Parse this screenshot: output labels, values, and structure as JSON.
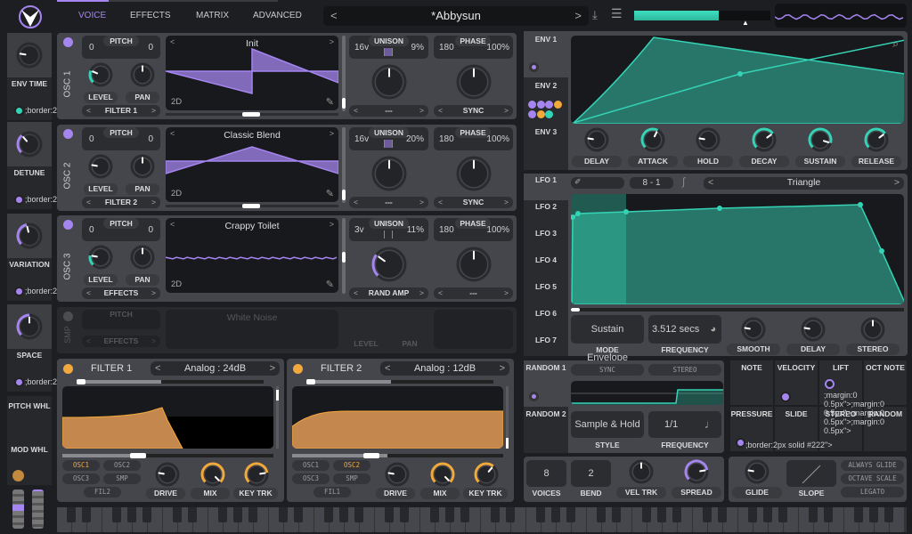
{
  "colors": {
    "accent": "#a585f0",
    "mod": "#35d3b5",
    "filter": "#f2a93b",
    "filter_fill": "#c4874e",
    "bg": "#1d1e21"
  },
  "header": {
    "tabs": [
      {
        "label": "VOICE",
        "active": true
      },
      {
        "label": "EFFECTS"
      },
      {
        "label": "MATRIX"
      },
      {
        "label": "ADVANCED"
      }
    ],
    "preset": {
      "name": "*Abbysun",
      "prev": "<",
      "next": ">"
    },
    "icons": [
      "save-icon",
      "menu-icon"
    ],
    "meter_level": 0.62
  },
  "macros": [
    {
      "label": "ENV TIME",
      "value": 0.2
    },
    {
      "label": "DETUNE",
      "value": 0.35
    },
    {
      "label": "VARIATION",
      "value": 0.45
    },
    {
      "label": "SPACE",
      "value": 0.5
    }
  ],
  "wheels": {
    "pitch_label": "PITCH WHL",
    "mod_label": "MOD WHL"
  },
  "osc": [
    {
      "label": "OSC 1",
      "pitch_l": "0",
      "pitch_r": "0",
      "pitch_title": "PITCH",
      "level_label": "LEVEL",
      "pan_label": "PAN",
      "level": 0.25,
      "pan": 0.5,
      "dest": "FILTER 1",
      "wavetable": "Init",
      "dim": "2D",
      "unison_title": "UNISON",
      "voices": "16v",
      "detune": "9%",
      "phase_title": "PHASE",
      "phase": "180",
      "phase_rand": "100%",
      "unison_knob": 0.5,
      "phase_knob": 0.5,
      "unison_sel": "---",
      "phase_sel": "SYNC"
    },
    {
      "label": "OSC 2",
      "pitch_l": "0",
      "pitch_r": "0",
      "pitch_title": "PITCH",
      "level_label": "LEVEL",
      "pan_label": "PAN",
      "level": 0.2,
      "pan": 0.5,
      "dest": "FILTER 2",
      "wavetable": "Classic Blend",
      "dim": "2D",
      "unison_title": "UNISON",
      "voices": "16v",
      "detune": "20%",
      "phase_title": "PHASE",
      "phase": "180",
      "phase_rand": "100%",
      "unison_knob": 0.5,
      "phase_knob": 0.5,
      "unison_sel": "---",
      "phase_sel": "SYNC"
    },
    {
      "label": "OSC 3",
      "pitch_l": "0",
      "pitch_r": "0",
      "pitch_title": "PITCH",
      "level_label": "LEVEL",
      "pan_label": "PAN",
      "level": 0.2,
      "pan": 0.5,
      "dest": "EFFECTS",
      "wavetable": "Crappy Toilet",
      "dim": "2D",
      "unison_title": "UNISON",
      "voices": "3v",
      "detune": "11%",
      "phase_title": "PHASE",
      "phase": "180",
      "phase_rand": "100%",
      "unison_knob": 0.3,
      "phase_knob": 0.5,
      "unison_sel": "RAND AMP",
      "phase_sel": "---"
    }
  ],
  "sample": {
    "label": "SMP",
    "pitch_title": "PITCH",
    "dest": "EFFECTS",
    "name": "White Noise",
    "level_label": "LEVEL",
    "pan_label": "PAN"
  },
  "filters": [
    {
      "title": "FILTER 1",
      "type": "Analog : 24dB",
      "sources": [
        "OSC1",
        "OSC2",
        "OSC3",
        "SMP",
        "FIL2"
      ],
      "active_source": 0,
      "knobs": [
        {
          "label": "DRIVE",
          "value": 0.2
        },
        {
          "label": "MIX",
          "value": 1.0
        },
        {
          "label": "KEY TRK",
          "value": 0.8
        }
      ]
    },
    {
      "title": "FILTER 2",
      "type": "Analog : 12dB",
      "sources": [
        "OSC1",
        "OSC2",
        "OSC3",
        "SMP",
        "FIL1"
      ],
      "active_source": 1,
      "knobs": [
        {
          "label": "DRIVE",
          "value": 0.2
        },
        {
          "label": "MIX",
          "value": 1.0
        },
        {
          "label": "KEY TRK",
          "value": 0.65
        }
      ]
    }
  ],
  "envelopes": {
    "tabs": [
      "ENV 1",
      "ENV 2",
      "ENV 3"
    ],
    "knobs": [
      {
        "label": "DELAY",
        "value": 0.2
      },
      {
        "label": "ATTACK",
        "value": 0.6
      },
      {
        "label": "HOLD",
        "value": 0.2
      },
      {
        "label": "DECAY",
        "value": 0.7
      },
      {
        "label": "SUSTAIN",
        "value": 0.9
      },
      {
        "label": "RELEASE",
        "value": 0.7
      }
    ]
  },
  "lfos": {
    "tabs": [
      "LFO 1",
      "LFO 2",
      "LFO 3",
      "LFO 4",
      "LFO 5",
      "LFO 6",
      "LFO 7"
    ],
    "grid_x": "8",
    "grid_sep": "-",
    "grid_y": "1",
    "shape": "Triangle",
    "mode": "Sustain Envelope",
    "mode_label": "MODE",
    "frequency": "3.512 secs",
    "frequency_label": "FREQUENCY",
    "knobs": [
      {
        "label": "SMOOTH",
        "value": 0.2
      },
      {
        "label": "DELAY",
        "value": 0.2
      },
      {
        "label": "STEREO",
        "value": 0.5
      }
    ]
  },
  "random": {
    "tabs": [
      "RANDOM 1",
      "RANDOM 2"
    ],
    "sync": "SYNC",
    "stereo": "STEREO",
    "style": "Sample & Hold",
    "style_label": "STYLE",
    "frequency": "1/1",
    "frequency_label": "FREQUENCY"
  },
  "mod_sources": [
    "NOTE",
    "VELOCITY",
    "LIFT",
    "OCT NOTE",
    "PRESSURE",
    "SLIDE",
    "STEREO",
    "RANDOM"
  ],
  "voice": {
    "voices": "8",
    "voices_label": "VOICES",
    "bend": "2",
    "bend_label": "BEND",
    "vel_trk_label": "VEL TRK",
    "vel_trk": 0.5,
    "spread_label": "SPREAD",
    "spread": 0.8,
    "glide_label": "GLIDE",
    "glide": 0.2,
    "slope_label": "SLOPE",
    "always_glide": "ALWAYS GLIDE",
    "octave_scale": "OCTAVE SCALE",
    "legato": "LEGATO"
  }
}
